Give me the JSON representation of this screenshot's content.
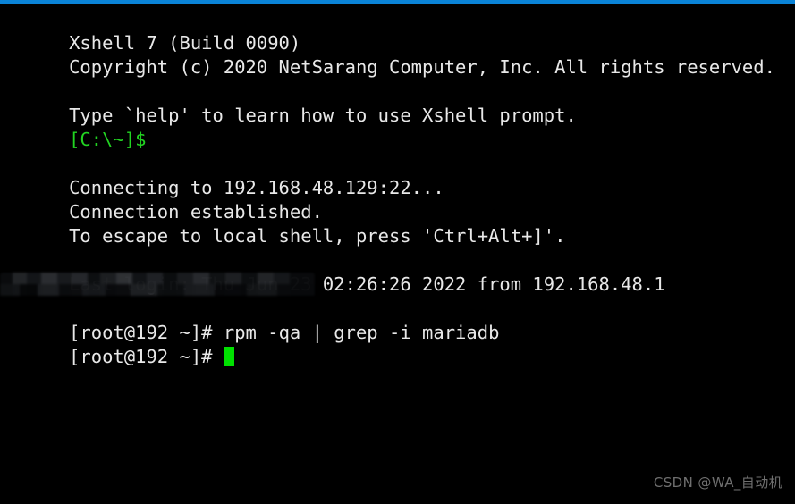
{
  "window": {
    "accent_color": "#0a84d8",
    "background_color": "#000000",
    "foreground_color": "#e8e8e8",
    "prompt_color": "#22d422",
    "cursor_color": "#00e000"
  },
  "terminal": {
    "banner": {
      "title": "Xshell 7 (Build 0090)",
      "copyright": "Copyright (c) 2020 NetSarang Computer, Inc. All rights reserved.",
      "help_hint": "Type `help' to learn how to use Xshell prompt.",
      "local_prompt": "[C:\\~]$"
    },
    "session": {
      "connecting": "Connecting to 192.168.48.129:22...",
      "established": "Connection established.",
      "escape_hint": "To escape to local shell, press 'Ctrl+Alt+]'.",
      "last_login": "Last login: Thu Jun 23 02:26:26 2022 from 192.168.48.1",
      "redacted_motd": ""
    },
    "shell": {
      "prompt": "[root@192 ~]# ",
      "command": "rpm -qa | grep -i mariadb",
      "prompt_current": "[root@192 ~]# ",
      "cursor": "block"
    },
    "blank": " "
  },
  "watermark": {
    "text": "CSDN @WA_自动机"
  }
}
